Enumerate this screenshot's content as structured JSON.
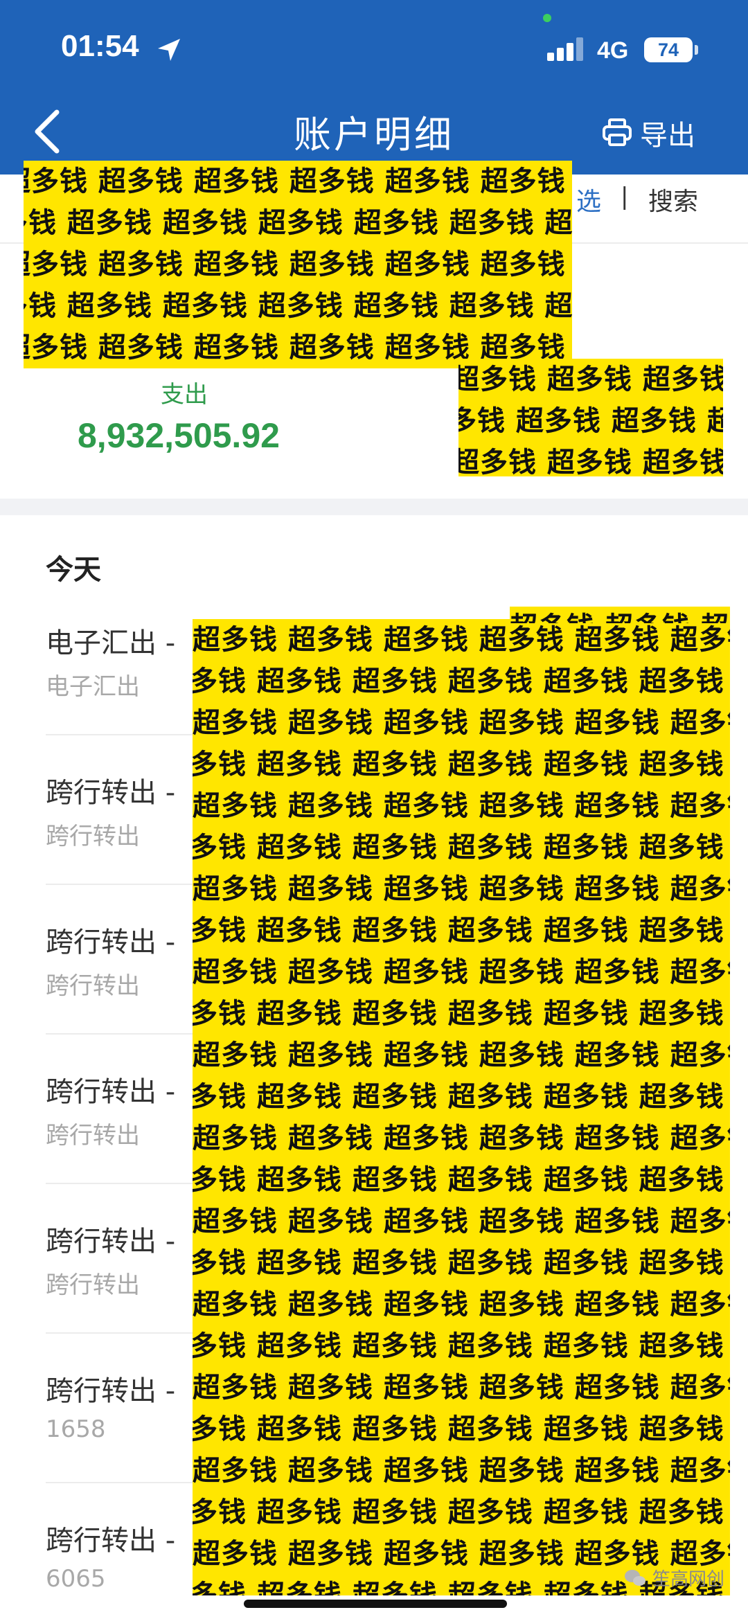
{
  "status_bar": {
    "time": "01:54",
    "network": "4G",
    "battery": "74"
  },
  "nav": {
    "title": "账户明细",
    "export_label": "导出"
  },
  "filter": {
    "filter_partial": "选",
    "separator": "|",
    "search_label": "搜索"
  },
  "summary": {
    "outflow_label": "支出",
    "outflow_value": "8,932,505.92",
    "outflow_color": "#2f9b4c"
  },
  "list": {
    "day_header": "今天",
    "transactions": [
      {
        "title": "电子汇出 -",
        "subtitle": "电子汇出"
      },
      {
        "title": "跨行转出 -",
        "subtitle": "跨行转出"
      },
      {
        "title": "跨行转出 -",
        "subtitle": "跨行转出"
      },
      {
        "title": "跨行转出 -",
        "subtitle": "跨行转出"
      },
      {
        "title": "跨行转出 -",
        "subtitle": "跨行转出"
      },
      {
        "title": "跨行转出 -",
        "subtitle": "1658"
      },
      {
        "title": "跨行转出 -",
        "subtitle": "6065"
      }
    ]
  },
  "redaction": {
    "pattern_text": "超多钱",
    "color": "#ffe600"
  },
  "watermark": {
    "text": "笙高网创"
  },
  "colors": {
    "header_blue": "#1f63b8",
    "link_blue": "#2d70c4"
  }
}
